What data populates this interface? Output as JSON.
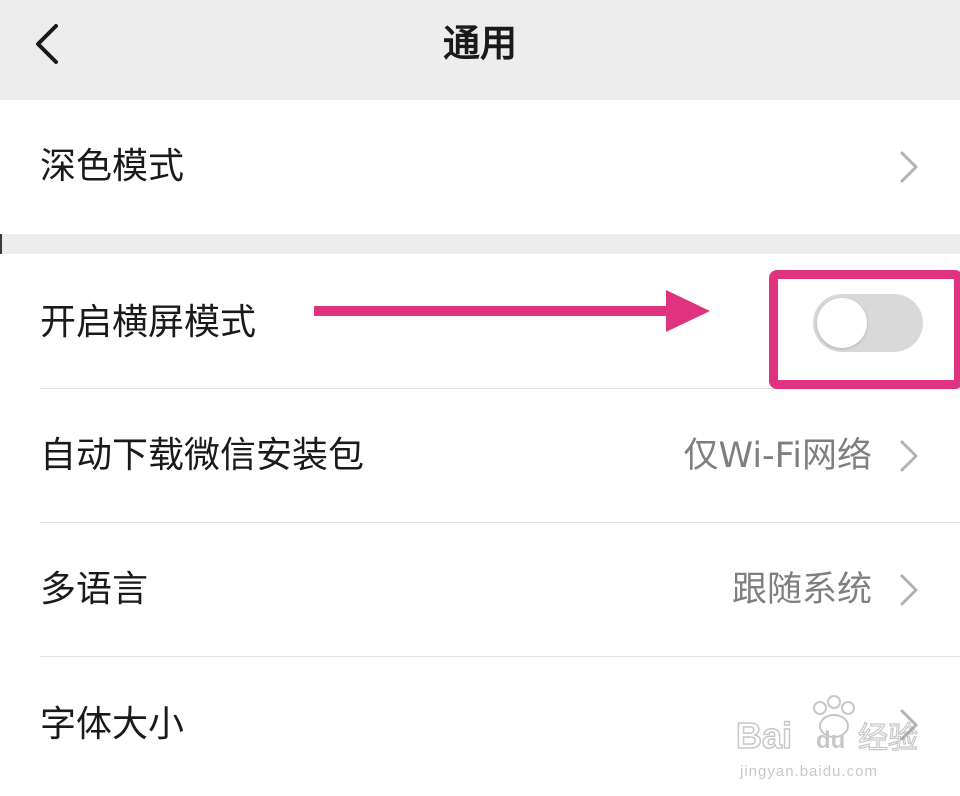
{
  "header": {
    "title": "通用"
  },
  "section1": {
    "dark_mode": {
      "label": "深色模式"
    }
  },
  "section2": {
    "landscape": {
      "label": "开启横屏模式",
      "toggle_on": false
    },
    "auto_download": {
      "label": "自动下载微信安装包",
      "value": "仅Wi-Fi网络"
    },
    "language": {
      "label": "多语言",
      "value": "跟随系统"
    },
    "font_size": {
      "label": "字体大小"
    }
  },
  "annotation": {
    "color": "#e0337f"
  },
  "watermark": {
    "brand": "Bai du 经验",
    "url": "jingyan.baidu.com"
  }
}
